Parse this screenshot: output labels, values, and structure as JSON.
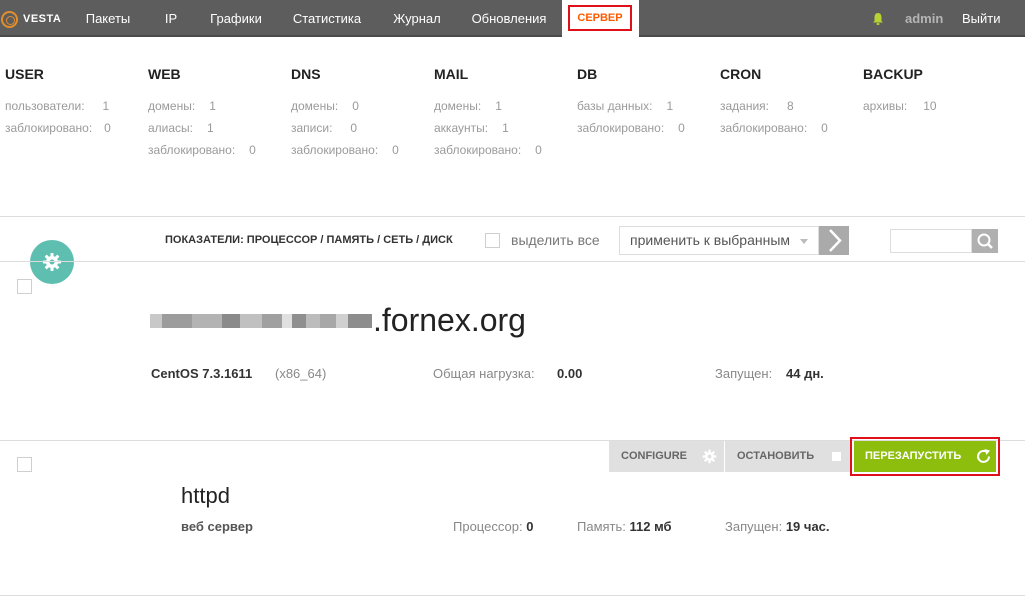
{
  "app": {
    "logo_text": "VESTA"
  },
  "nav": {
    "items": [
      "Пакеты",
      "IP",
      "Графики",
      "Статистика",
      "Журнал",
      "Обновления"
    ],
    "active": "СЕРВЕР",
    "user": "admin",
    "logout": "Выйти"
  },
  "stats": [
    {
      "title": "USER",
      "lines": [
        {
          "label": "пользователи:",
          "value": "1"
        },
        {
          "label": "заблокировано:",
          "value": "0"
        }
      ]
    },
    {
      "title": "WEB",
      "lines": [
        {
          "label": "домены:",
          "value": "1"
        },
        {
          "label": "алиасы:",
          "value": "1"
        },
        {
          "label": "заблокировано:",
          "value": "0"
        }
      ]
    },
    {
      "title": "DNS",
      "lines": [
        {
          "label": "домены:",
          "value": "0"
        },
        {
          "label": "записи:",
          "value": "0"
        },
        {
          "label": "заблокировано:",
          "value": "0"
        }
      ]
    },
    {
      "title": "MAIL",
      "lines": [
        {
          "label": "домены:",
          "value": "1"
        },
        {
          "label": "аккаунты:",
          "value": "1"
        },
        {
          "label": "заблокировано:",
          "value": "0"
        }
      ]
    },
    {
      "title": "DB",
      "lines": [
        {
          "label": "базы данных:",
          "value": "1"
        },
        {
          "label": "заблокировано:",
          "value": "0"
        }
      ]
    },
    {
      "title": "CRON",
      "lines": [
        {
          "label": "задания:",
          "value": "8"
        },
        {
          "label": "заблокировано:",
          "value": "0"
        }
      ]
    },
    {
      "title": "BACKUP",
      "lines": [
        {
          "label": "архивы:",
          "value": "10"
        }
      ]
    }
  ],
  "toolbar": {
    "metrics_label": "ПОКАЗАТЕЛИ: ПРОЦЕССОР / ПАМЯТЬ / СЕТЬ / ДИСК",
    "select_all": "выделить все",
    "apply_selected": "применить к выбранным"
  },
  "server": {
    "hostname_suffix": ".fornex.org",
    "os": "CentOS 7.3.1611",
    "arch": "(x86_64)",
    "load_label": "Общая нагрузка:",
    "load_value": "0.00",
    "uptime_label": "Запущен:",
    "uptime_value": "44 дн."
  },
  "service": {
    "configure": "CONFIGURE",
    "stop": "ОСТАНОВИТЬ",
    "restart": "ПЕРЕЗАПУСТИТЬ",
    "name": "httpd",
    "description": "веб сервер",
    "cpu_label": "Процессор:",
    "cpu_value": "0",
    "mem_label": "Память:",
    "mem_value": "112 мб",
    "uptime_label": "Запущен:",
    "uptime_value": "19 час."
  },
  "colors": {
    "accent_orange": "#ff5a00",
    "highlight_red": "#e0101b",
    "restart_green": "#8dbd0d",
    "fab_teal": "#5ebfb0",
    "topbar": "#5d5d5d"
  }
}
